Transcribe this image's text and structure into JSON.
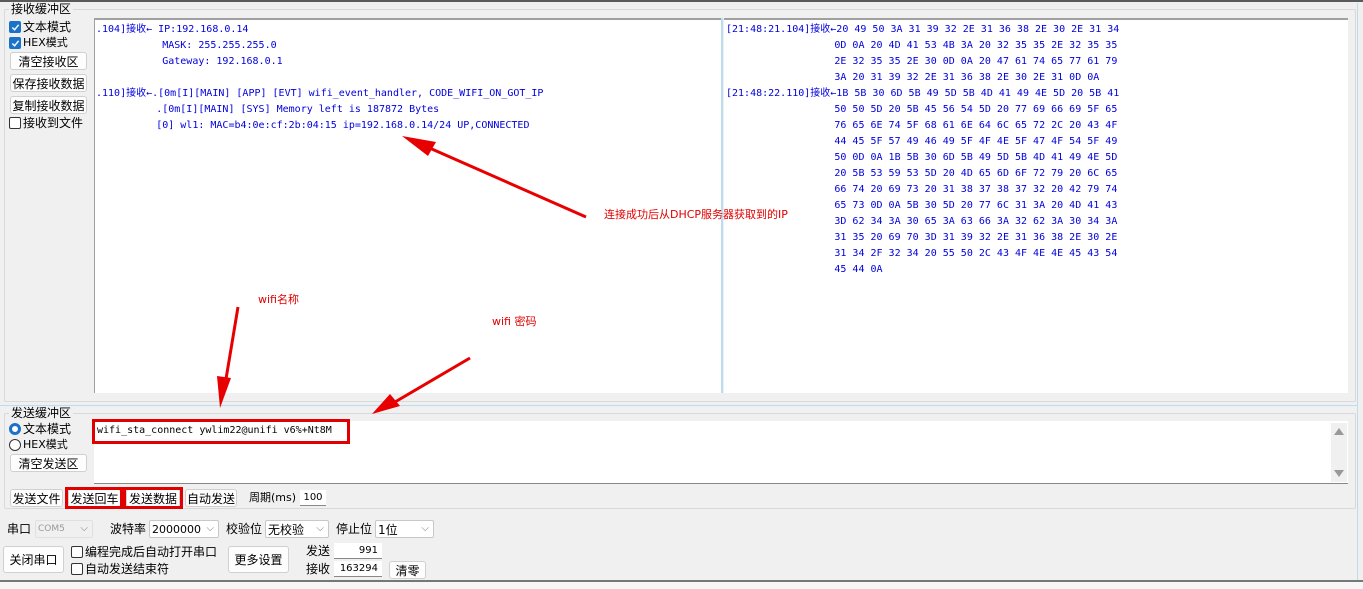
{
  "receive": {
    "group_title": "接收缓冲区",
    "text_mode_label": "文本模式",
    "text_mode_checked": true,
    "hex_mode_label": "HEX模式",
    "hex_mode_checked": true,
    "clear_button": "清空接收区",
    "save_button": "保存接收数据",
    "copy_button": "复制接收数据",
    "to_file_label": "接收到文件",
    "to_file_checked": false,
    "text_lines": [
      ".104]接收← IP:192.168.0.14",
      "           MASK: 255.255.255.0",
      "           Gateway: 192.168.0.1",
      "",
      ".110]接收←.[0m[I][MAIN] [APP] [EVT] wifi_event_handler, CODE_WIFI_ON_GOT_IP",
      "          .[0m[I][MAIN] [SYS] Memory left is 187872 Bytes",
      "          [0] wl1: MAC=b4:0e:cf:2b:04:15 ip=192.168.0.14/24 UP,CONNECTED"
    ],
    "hex_lines": [
      "[21:48:21.104]接收←20 49 50 3A 31 39 32 2E 31 36 38 2E 30 2E 31 34",
      "                  0D 0A 20 4D 41 53 4B 3A 20 32 35 35 2E 32 35 35",
      "                  2E 32 35 35 2E 30 0D 0A 20 47 61 74 65 77 61 79",
      "                  3A 20 31 39 32 2E 31 36 38 2E 30 2E 31 0D 0A",
      "[21:48:22.110]接收←1B 5B 30 6D 5B 49 5D 5B 4D 41 49 4E 5D 20 5B 41",
      "                  50 50 5D 20 5B 45 56 54 5D 20 77 69 66 69 5F 65",
      "                  76 65 6E 74 5F 68 61 6E 64 6C 65 72 2C 20 43 4F",
      "                  44 45 5F 57 49 46 49 5F 4F 4E 5F 47 4F 54 5F 49",
      "                  50 0D 0A 1B 5B 30 6D 5B 49 5D 5B 4D 41 49 4E 5D",
      "                  20 5B 53 59 53 5D 20 4D 65 6D 6F 72 79 20 6C 65",
      "                  66 74 20 69 73 20 31 38 37 38 37 32 20 42 79 74",
      "                  65 73 0D 0A 5B 30 5D 20 77 6C 31 3A 20 4D 41 43",
      "                  3D 62 34 3A 30 65 3A 63 66 3A 32 62 3A 30 34 3A",
      "                  31 35 20 69 70 3D 31 39 32 2E 31 36 38 2E 30 2E",
      "                  31 34 2F 32 34 20 55 50 2C 43 4F 4E 4E 45 43 54",
      "                  45 44 0A"
    ]
  },
  "send": {
    "group_title": "发送缓冲区",
    "text_mode_label": "文本模式",
    "text_mode_selected": true,
    "hex_mode_label": "HEX模式",
    "clear_button": "清空发送区",
    "input_value": "wifi_sta_connect ywlim22@unifi v6%+Nt8M",
    "send_file_button": "发送文件",
    "send_enter_button": "发送回车",
    "send_data_button": "发送数据",
    "auto_send_button": "自动发送",
    "period_label": "周期(ms)",
    "period_value": "100"
  },
  "port": {
    "port_label": "串口",
    "port_value": "COM5",
    "baud_label": "波特率",
    "baud_value": "2000000",
    "parity_label": "校验位",
    "parity_value": "无校验",
    "stop_label": "停止位",
    "stop_value": "1位",
    "close_button": "关闭串口",
    "auto_open_label": "编程完成后自动打开串口",
    "auto_open_checked": false,
    "auto_end_label": "自动发送结束符",
    "auto_end_checked": false,
    "more_settings_button": "更多设置",
    "sent_label": "发送",
    "sent_count": "991",
    "recv_label": "接收",
    "recv_count": "163294",
    "clear_counts_button": "清零"
  },
  "annotations": {
    "ip_note": "连接成功后从DHCP服务器获取到的IP",
    "ssid_note": "wifi名称",
    "password_note": "wifi 密码",
    "color": "#e00000"
  }
}
